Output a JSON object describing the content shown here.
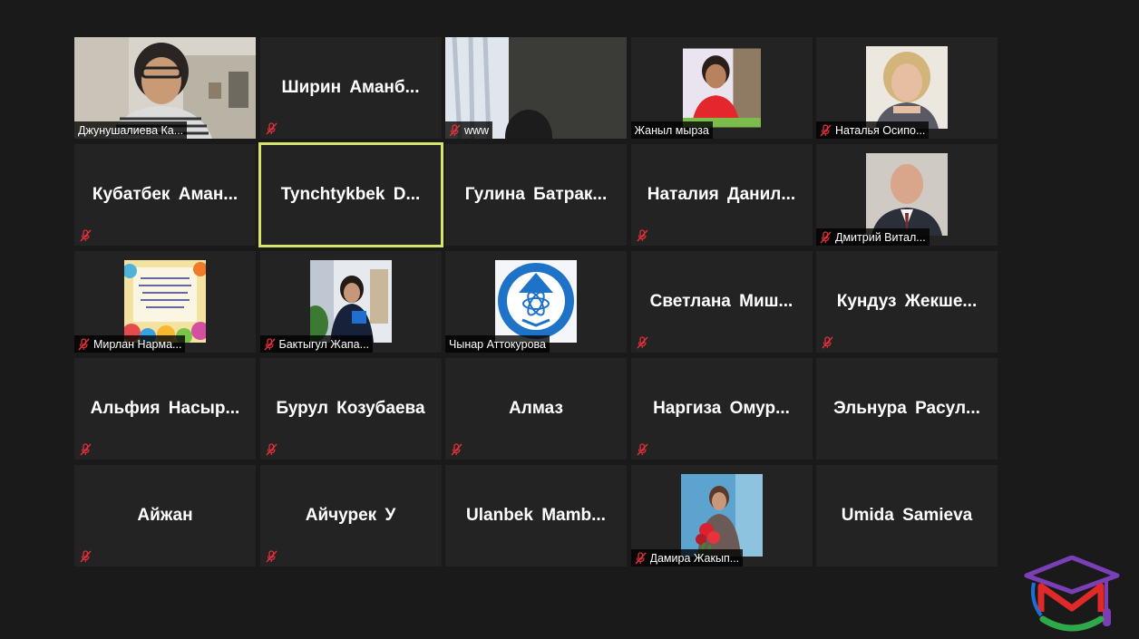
{
  "participants": [
    {
      "name": "Джунушалиева Ка...",
      "display": "label",
      "muted": false,
      "media": "video-woman-glasses"
    },
    {
      "name": "Ширин Аманб...",
      "display": "big",
      "muted": true
    },
    {
      "name": "www",
      "display": "label",
      "muted": true,
      "media": "video-window"
    },
    {
      "name": "Жаныл мырза",
      "display": "label",
      "muted": false,
      "media": "photo-girl-red"
    },
    {
      "name": "Наталья Осипо...",
      "display": "label",
      "muted": true,
      "media": "photo-woman-blonde"
    },
    {
      "name": "Кубатбек Аман...",
      "display": "big",
      "muted": true
    },
    {
      "name": "Tynchtykbek D...",
      "display": "big",
      "muted": false,
      "active": true
    },
    {
      "name": "Гулина Батрак...",
      "display": "big",
      "muted": false
    },
    {
      "name": "Наталия Данил...",
      "display": "big",
      "muted": true
    },
    {
      "name": "Дмитрий Витал...",
      "display": "label",
      "muted": true,
      "media": "photo-man-suit"
    },
    {
      "name": "Мирлан Нарма...",
      "display": "label",
      "muted": true,
      "media": "photo-card"
    },
    {
      "name": "Бактыгул Жапа...",
      "display": "label",
      "muted": true,
      "media": "photo-woman-blue"
    },
    {
      "name": "Чынар Аттокурова",
      "display": "label",
      "muted": false,
      "media": "photo-emblem"
    },
    {
      "name": "Светлана Миш...",
      "display": "big",
      "muted": true
    },
    {
      "name": "Кундуз Жекше...",
      "display": "big",
      "muted": true
    },
    {
      "name": "Альфия Насыр...",
      "display": "big",
      "muted": true
    },
    {
      "name": "Бурул Козубаева",
      "display": "big",
      "muted": true
    },
    {
      "name": "Алмаз",
      "display": "big",
      "muted": true
    },
    {
      "name": "Наргиза Омур...",
      "display": "big",
      "muted": true
    },
    {
      "name": "Эльнура Расул...",
      "display": "big",
      "muted": false
    },
    {
      "name": "Айжан",
      "display": "big",
      "muted": true
    },
    {
      "name": "Айчурек У",
      "display": "big",
      "muted": true
    },
    {
      "name": "Ulanbek Mamb...",
      "display": "big",
      "muted": false
    },
    {
      "name": "Дамира Жакып...",
      "display": "label",
      "muted": true,
      "media": "photo-woman-flowers"
    },
    {
      "name": "Umida Samieva",
      "display": "big",
      "muted": false
    }
  ],
  "colors": {
    "background": "#1a1a1a",
    "tile": "#232323",
    "active_border": "#d6e46a",
    "muted_icon": "#e0303a"
  },
  "icons": {
    "muted": "microphone-muted-icon",
    "logo": "graduation-cap-m-logo"
  }
}
